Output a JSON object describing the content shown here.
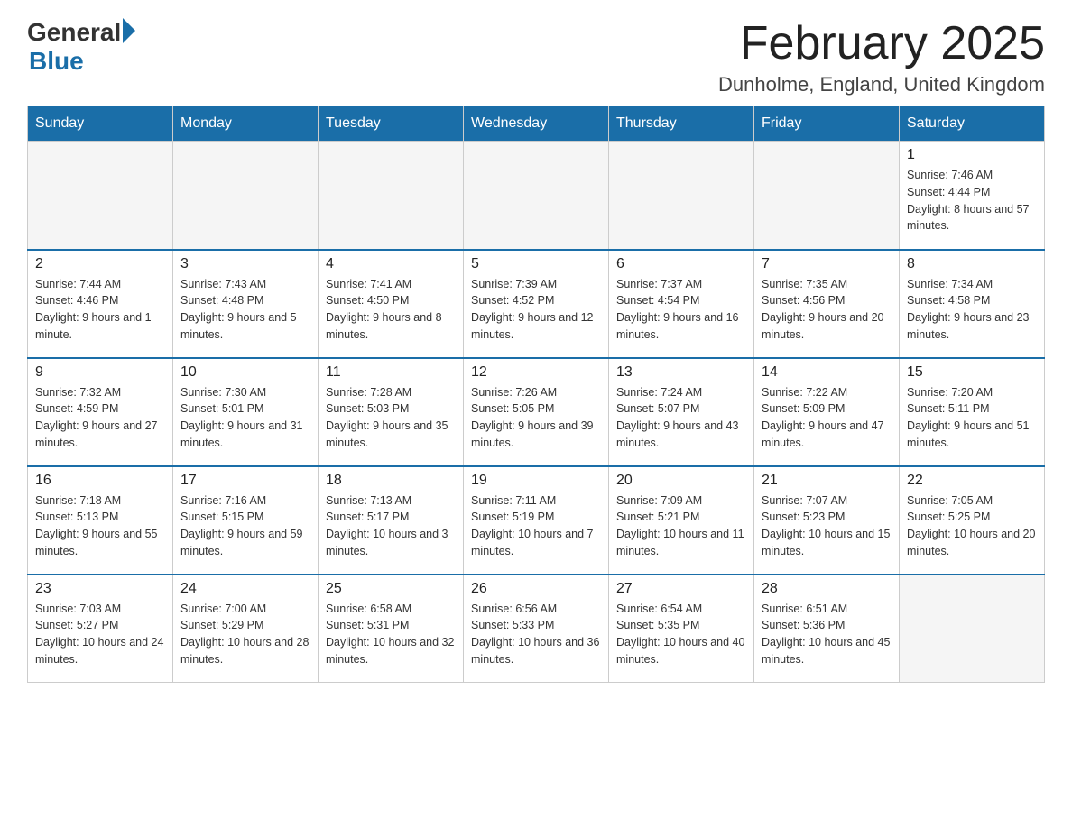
{
  "header": {
    "logo_general": "General",
    "logo_blue": "Blue",
    "title": "February 2025",
    "location": "Dunholme, England, United Kingdom"
  },
  "days_of_week": [
    "Sunday",
    "Monday",
    "Tuesday",
    "Wednesday",
    "Thursday",
    "Friday",
    "Saturday"
  ],
  "weeks": [
    [
      {
        "day": "",
        "empty": true
      },
      {
        "day": "",
        "empty": true
      },
      {
        "day": "",
        "empty": true
      },
      {
        "day": "",
        "empty": true
      },
      {
        "day": "",
        "empty": true
      },
      {
        "day": "",
        "empty": true
      },
      {
        "day": "1",
        "sunrise": "7:46 AM",
        "sunset": "4:44 PM",
        "daylight": "8 hours and 57 minutes."
      }
    ],
    [
      {
        "day": "2",
        "sunrise": "7:44 AM",
        "sunset": "4:46 PM",
        "daylight": "9 hours and 1 minute."
      },
      {
        "day": "3",
        "sunrise": "7:43 AM",
        "sunset": "4:48 PM",
        "daylight": "9 hours and 5 minutes."
      },
      {
        "day": "4",
        "sunrise": "7:41 AM",
        "sunset": "4:50 PM",
        "daylight": "9 hours and 8 minutes."
      },
      {
        "day": "5",
        "sunrise": "7:39 AM",
        "sunset": "4:52 PM",
        "daylight": "9 hours and 12 minutes."
      },
      {
        "day": "6",
        "sunrise": "7:37 AM",
        "sunset": "4:54 PM",
        "daylight": "9 hours and 16 minutes."
      },
      {
        "day": "7",
        "sunrise": "7:35 AM",
        "sunset": "4:56 PM",
        "daylight": "9 hours and 20 minutes."
      },
      {
        "day": "8",
        "sunrise": "7:34 AM",
        "sunset": "4:58 PM",
        "daylight": "9 hours and 23 minutes."
      }
    ],
    [
      {
        "day": "9",
        "sunrise": "7:32 AM",
        "sunset": "4:59 PM",
        "daylight": "9 hours and 27 minutes."
      },
      {
        "day": "10",
        "sunrise": "7:30 AM",
        "sunset": "5:01 PM",
        "daylight": "9 hours and 31 minutes."
      },
      {
        "day": "11",
        "sunrise": "7:28 AM",
        "sunset": "5:03 PM",
        "daylight": "9 hours and 35 minutes."
      },
      {
        "day": "12",
        "sunrise": "7:26 AM",
        "sunset": "5:05 PM",
        "daylight": "9 hours and 39 minutes."
      },
      {
        "day": "13",
        "sunrise": "7:24 AM",
        "sunset": "5:07 PM",
        "daylight": "9 hours and 43 minutes."
      },
      {
        "day": "14",
        "sunrise": "7:22 AM",
        "sunset": "5:09 PM",
        "daylight": "9 hours and 47 minutes."
      },
      {
        "day": "15",
        "sunrise": "7:20 AM",
        "sunset": "5:11 PM",
        "daylight": "9 hours and 51 minutes."
      }
    ],
    [
      {
        "day": "16",
        "sunrise": "7:18 AM",
        "sunset": "5:13 PM",
        "daylight": "9 hours and 55 minutes."
      },
      {
        "day": "17",
        "sunrise": "7:16 AM",
        "sunset": "5:15 PM",
        "daylight": "9 hours and 59 minutes."
      },
      {
        "day": "18",
        "sunrise": "7:13 AM",
        "sunset": "5:17 PM",
        "daylight": "10 hours and 3 minutes."
      },
      {
        "day": "19",
        "sunrise": "7:11 AM",
        "sunset": "5:19 PM",
        "daylight": "10 hours and 7 minutes."
      },
      {
        "day": "20",
        "sunrise": "7:09 AM",
        "sunset": "5:21 PM",
        "daylight": "10 hours and 11 minutes."
      },
      {
        "day": "21",
        "sunrise": "7:07 AM",
        "sunset": "5:23 PM",
        "daylight": "10 hours and 15 minutes."
      },
      {
        "day": "22",
        "sunrise": "7:05 AM",
        "sunset": "5:25 PM",
        "daylight": "10 hours and 20 minutes."
      }
    ],
    [
      {
        "day": "23",
        "sunrise": "7:03 AM",
        "sunset": "5:27 PM",
        "daylight": "10 hours and 24 minutes."
      },
      {
        "day": "24",
        "sunrise": "7:00 AM",
        "sunset": "5:29 PM",
        "daylight": "10 hours and 28 minutes."
      },
      {
        "day": "25",
        "sunrise": "6:58 AM",
        "sunset": "5:31 PM",
        "daylight": "10 hours and 32 minutes."
      },
      {
        "day": "26",
        "sunrise": "6:56 AM",
        "sunset": "5:33 PM",
        "daylight": "10 hours and 36 minutes."
      },
      {
        "day": "27",
        "sunrise": "6:54 AM",
        "sunset": "5:35 PM",
        "daylight": "10 hours and 40 minutes."
      },
      {
        "day": "28",
        "sunrise": "6:51 AM",
        "sunset": "5:36 PM",
        "daylight": "10 hours and 45 minutes."
      },
      {
        "day": "",
        "empty": true
      }
    ]
  ]
}
